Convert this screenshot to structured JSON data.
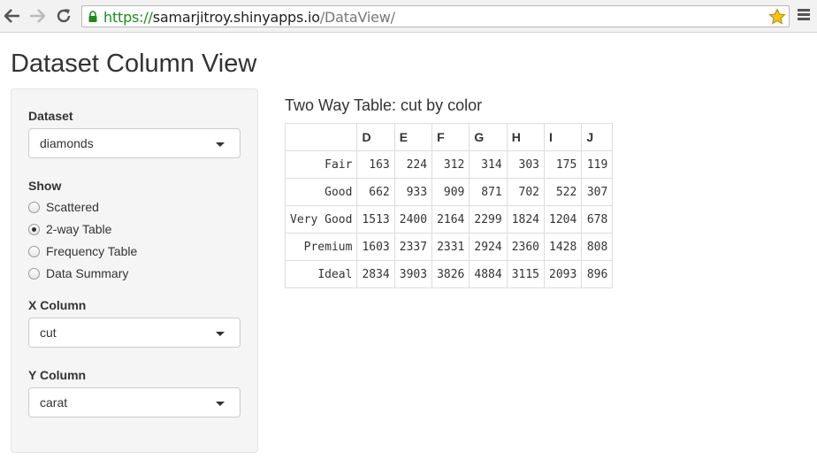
{
  "browser": {
    "url_scheme": "https://",
    "url_host": "samarjitroy.shinyapps.io",
    "url_path": "/DataView/"
  },
  "page": {
    "title": "Dataset Column View"
  },
  "sidebar": {
    "dataset_label": "Dataset",
    "dataset_value": "diamonds",
    "show_label": "Show",
    "show_options": [
      {
        "label": "Scattered",
        "checked": false
      },
      {
        "label": "2-way Table",
        "checked": true
      },
      {
        "label": "Frequency Table",
        "checked": false
      },
      {
        "label": "Data Summary",
        "checked": false
      }
    ],
    "xcol_label": "X Column",
    "xcol_value": "cut",
    "ycol_label": "Y Column",
    "ycol_value": "carat"
  },
  "output": {
    "title": "Two Way Table: cut by color",
    "columns": [
      "",
      "D",
      "E",
      "F",
      "G",
      "H",
      "I",
      "J"
    ],
    "rows": [
      {
        "label": "Fair",
        "values": [
          "163",
          "224",
          "312",
          "314",
          "303",
          "175",
          "119"
        ]
      },
      {
        "label": "Good",
        "values": [
          "662",
          "933",
          "909",
          "871",
          "702",
          "522",
          "307"
        ]
      },
      {
        "label": "Very Good",
        "values": [
          "1513",
          "2400",
          "2164",
          "2299",
          "1824",
          "1204",
          "678"
        ]
      },
      {
        "label": "Premium",
        "values": [
          "1603",
          "2337",
          "2331",
          "2924",
          "2360",
          "1428",
          "808"
        ]
      },
      {
        "label": "Ideal",
        "values": [
          "2834",
          "3903",
          "3826",
          "4884",
          "3115",
          "2093",
          "896"
        ]
      }
    ]
  }
}
